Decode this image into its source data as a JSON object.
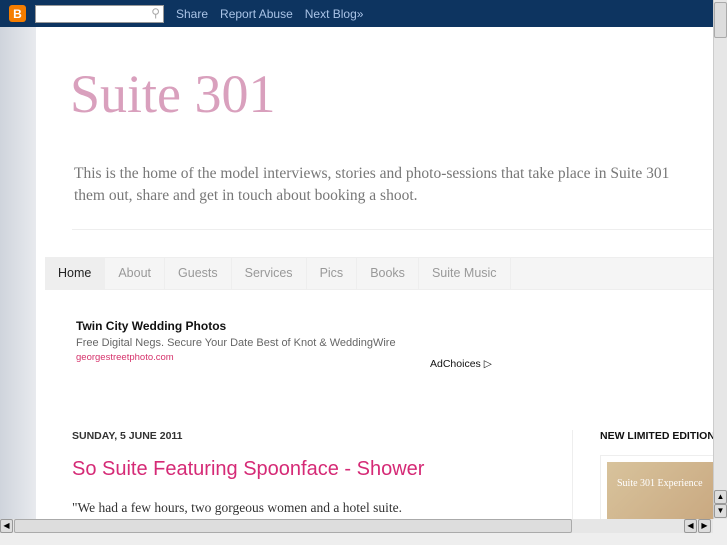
{
  "navbar": {
    "links": [
      "Share",
      "Report Abuse",
      "Next Blog»"
    ],
    "search_placeholder": ""
  },
  "blog": {
    "title": "Suite 301",
    "description_line1": "This is the home of the model interviews, stories and photo-sessions that take place in Suite 301",
    "description_line2": "them out, share and get in touch about booking a shoot."
  },
  "tabs": [
    "Home",
    "About",
    "Guests",
    "Services",
    "Pics",
    "Books",
    "Suite Music"
  ],
  "ad": {
    "title": "Twin City Wedding Photos",
    "text": "Free Digital Negs. Secure Your Date Best of Knot & WeddingWire",
    "url": "georgestreetphoto.com",
    "adchoices": "AdChoices ▷"
  },
  "post": {
    "date": "SUNDAY, 5 JUNE 2011",
    "title": "So Suite Featuring Spoonface - Shower",
    "body": "\"We had a few hours, two gorgeous women and a hotel suite."
  },
  "sidebar": {
    "heading": "NEW LIMITED EDITION",
    "image_text": "Suite 301 Experience"
  }
}
